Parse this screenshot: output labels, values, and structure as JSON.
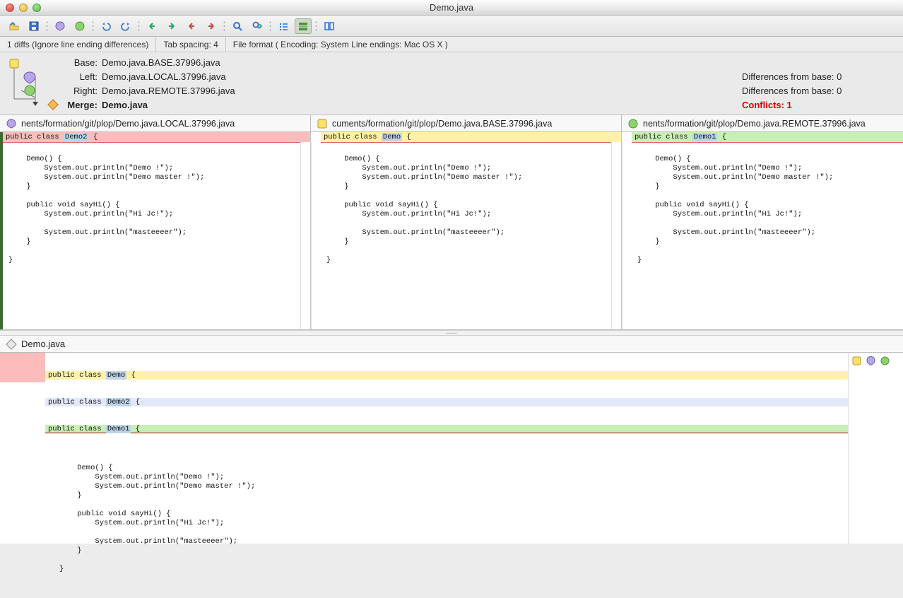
{
  "titlebar": {
    "title": "Demo.java"
  },
  "statusbar": {
    "diffs": "1 diffs (Ignore line ending differences)",
    "tabs": "Tab spacing: 4",
    "fileformat": "File format ( Encoding: System  Line endings: Mac OS X )"
  },
  "merge_header": {
    "base": {
      "label": "Base:",
      "value": "Demo.java.BASE.37996.java"
    },
    "left": {
      "label": "Left:",
      "value": "Demo.java.LOCAL.37996.java",
      "diff": "Differences from base: 0"
    },
    "right": {
      "label": "Right:",
      "value": "Demo.java.REMOTE.37996.java",
      "diff": "Differences from base: 0"
    },
    "merge": {
      "label": "Merge:",
      "value": "Demo.java",
      "diff": "Conflicts: 1"
    }
  },
  "panes": {
    "left": {
      "title": "nents/formation/git/plop/Demo.java.LOCAL.37996.java",
      "header_pre": "public class ",
      "header_hl": "Demo2",
      "header_post": " {",
      "code": "\n    Demo() {\n        System.out.println(\"Demo !\");\n        System.out.println(\"Demo master !\");\n    }\n\n    public void sayHi() {\n        System.out.println(\"Hi Jc!\");\n\n        System.out.println(\"masteeeer\");\n    }\n\n}\n"
    },
    "base": {
      "title": "cuments/formation/git/plop/Demo.java.BASE.37996.java",
      "header_pre": "public class ",
      "header_hl": "Demo",
      "header_post": " {",
      "code": "\n    Demo() {\n        System.out.println(\"Demo !\");\n        System.out.println(\"Demo master !\");\n    }\n\n    public void sayHi() {\n        System.out.println(\"Hi Jc!\");\n\n        System.out.println(\"masteeeer\");\n    }\n\n}\n"
    },
    "right": {
      "title": "nents/formation/git/plop/Demo.java.REMOTE.37996.java",
      "header_pre": "public class ",
      "header_hl": "Demo1",
      "header_post": " {",
      "code": "\n    Demo() {\n        System.out.println(\"Demo !\");\n        System.out.println(\"Demo master !\");\n    }\n\n    public void sayHi() {\n        System.out.println(\"Hi Jc!\");\n\n        System.out.println(\"masteeeer\");\n    }\n\n}\n"
    }
  },
  "merge_pane": {
    "title": "Demo.java",
    "lines": {
      "l0_pre": "public class ",
      "l0_hl": "Demo",
      "l0_post": " {",
      "l1_pre": "public class ",
      "l1_hl": "Demo2",
      "l1_post": " {",
      "l2_pre": "public class ",
      "l2_hl": "Demo1",
      "l2_post": " {"
    },
    "body": "\n    Demo() {\n        System.out.println(\"Demo !\");\n        System.out.println(\"Demo master !\");\n    }\n\n    public void sayHi() {\n        System.out.println(\"Hi Jc!\");\n\n        System.out.println(\"masteeeer\");\n    }\n\n}\n"
  }
}
